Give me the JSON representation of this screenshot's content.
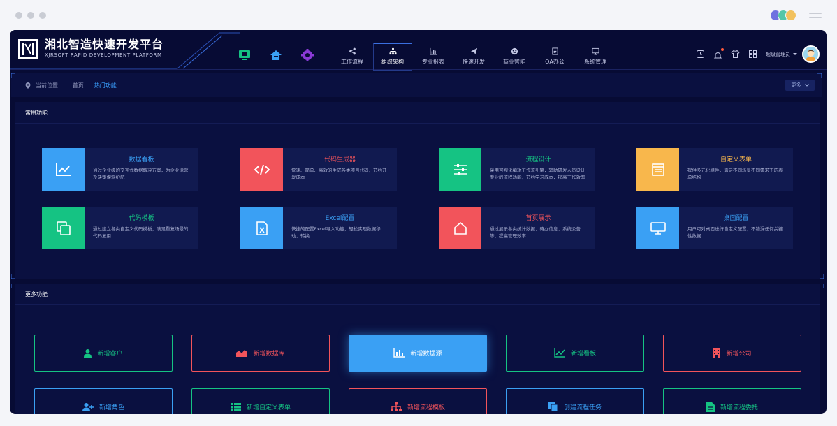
{
  "colors": {
    "bg": "#070b34",
    "panel": "#0a1040",
    "card": "#111a50",
    "blue": "#3aa0f4",
    "red": "#f2545b",
    "green": "#15c383",
    "orange": "#f8b74c",
    "accent": "#3aa0ff"
  },
  "brand": {
    "title": "湘北智造快速开发平台",
    "subtitle": "XJRSOFT RAPID DEVELOPMENT PLATFORM"
  },
  "quick_icons": [
    "monitor-icon",
    "home-icon",
    "gear-icon"
  ],
  "nav": [
    {
      "label": "工作流程",
      "icon": "share-icon"
    },
    {
      "label": "组织架构",
      "icon": "org-chart-icon",
      "active": true
    },
    {
      "label": "专业报表",
      "icon": "bar-chart-icon"
    },
    {
      "label": "快速开发",
      "icon": "send-icon"
    },
    {
      "label": "商业智能",
      "icon": "ai-icon"
    },
    {
      "label": "OA办公",
      "icon": "doc-icon"
    },
    {
      "label": "系统管理",
      "icon": "monitor-icon"
    }
  ],
  "right_tools": [
    "clock-icon",
    "bell-icon",
    "shirt-icon",
    "apps-icon"
  ],
  "user": {
    "name": "超级管理员"
  },
  "breadcrumb": {
    "label": "当前位置:",
    "home": "首页",
    "current": "热门功能",
    "more": "更多"
  },
  "common": {
    "title": "常用功能",
    "items": [
      {
        "title": "数据看板",
        "desc": "通过企业级的交互式数据解决方案，为企业运营及决策保驾护航",
        "color": "blue",
        "icon": "line-chart-icon"
      },
      {
        "title": "代码生成器",
        "desc": "快速、简单、高效的生成各类项目代码，节约开发成本",
        "color": "red",
        "icon": "code-icon"
      },
      {
        "title": "流程设计",
        "desc": "采用可视化编辑工作流引擎，辅助研发人员设计专业的流程功能，节约学习成本，提高工作效率",
        "color": "green",
        "icon": "sliders-icon"
      },
      {
        "title": "自定义表单",
        "desc": "提供多元化组件，满足不同场景不同需求下的表单结构",
        "color": "orange",
        "icon": "form-icon"
      },
      {
        "title": "代码模板",
        "desc": "通过建立各类自定义代码模板，满足重复场景的代码复用",
        "color": "green",
        "icon": "copy-icon"
      },
      {
        "title": "Excel配置",
        "desc": "快捷的配置Excel导入功能，轻松实现数据移动、转换",
        "color": "blue",
        "icon": "excel-icon"
      },
      {
        "title": "首页展示",
        "desc": "通过展示各类统计数据、待办信息、系统公告等，提高管理效率",
        "color": "red",
        "icon": "home-icon"
      },
      {
        "title": "桌面配置",
        "desc": "用户可对桌面进行自定义配置，不错漏任何关键性数据",
        "color": "blue",
        "icon": "desktop-icon"
      }
    ]
  },
  "more": {
    "title": "更多功能",
    "actions": [
      {
        "label": "新增客户",
        "color": "green",
        "icon": "user-icon"
      },
      {
        "label": "新增数据库",
        "color": "red",
        "icon": "area-chart-icon"
      },
      {
        "label": "新增数据源",
        "color": "blue",
        "icon": "bar-chart-icon",
        "active": true
      },
      {
        "label": "新增看板",
        "color": "green",
        "icon": "line-chart-icon"
      },
      {
        "label": "新增公司",
        "color": "red",
        "icon": "building-icon"
      },
      {
        "label": "新增角色",
        "color": "blue",
        "icon": "user-plus-icon"
      },
      {
        "label": "新增自定义表单",
        "color": "green",
        "icon": "list-icon"
      },
      {
        "label": "新增流程模板",
        "color": "red",
        "icon": "sitemap-icon"
      },
      {
        "label": "创建流程任务",
        "color": "blue",
        "icon": "copy-icon"
      },
      {
        "label": "新增流程委托",
        "color": "green",
        "icon": "file-icon"
      }
    ]
  }
}
